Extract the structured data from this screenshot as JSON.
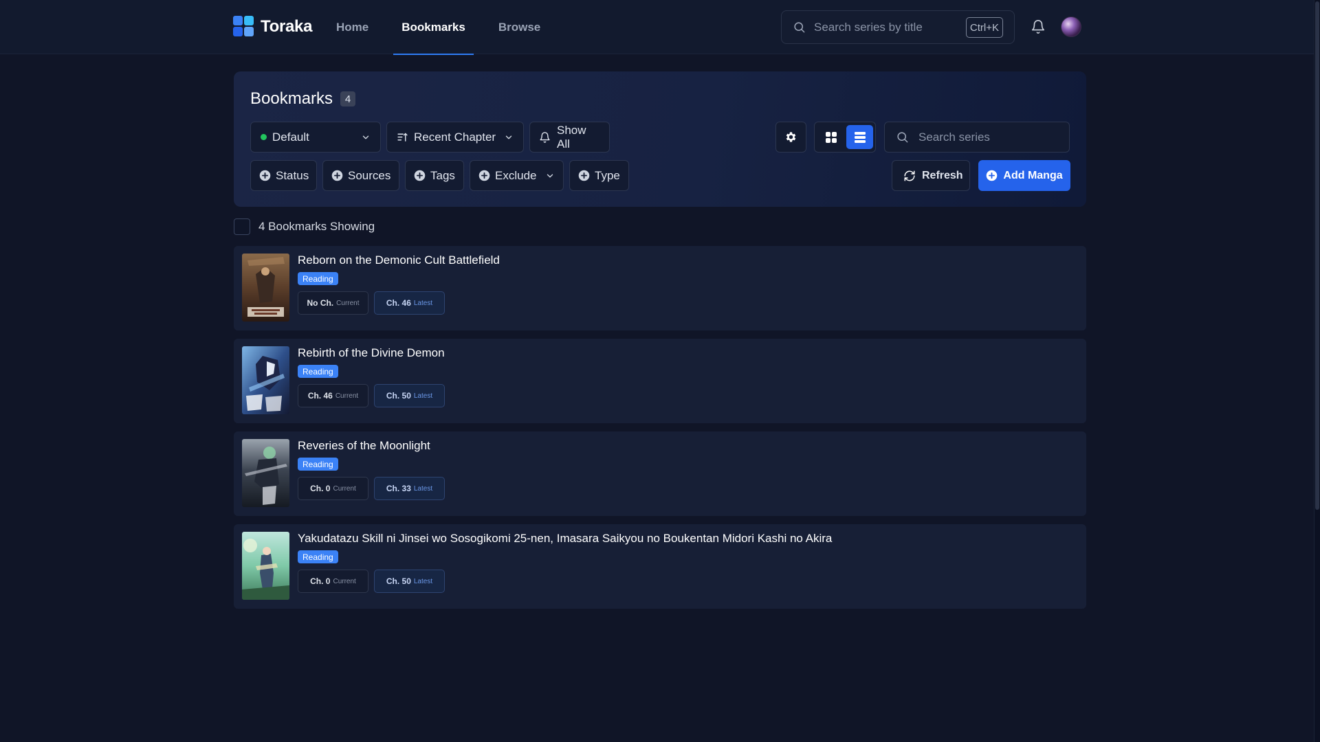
{
  "app": {
    "name": "Toraka"
  },
  "nav": {
    "items": [
      {
        "label": "Home",
        "active": false
      },
      {
        "label": "Bookmarks",
        "active": true
      },
      {
        "label": "Browse",
        "active": false
      }
    ]
  },
  "top_search": {
    "placeholder": "Search series by title",
    "shortcut": "Ctrl+K"
  },
  "icons": {
    "notifications": "bell-icon",
    "user": "avatar"
  },
  "panel": {
    "title": "Bookmarks",
    "count": "4",
    "list_filter": {
      "label": "Default",
      "status_color": "#22c55e"
    },
    "sort": {
      "label": "Recent Chapter"
    },
    "notify": {
      "label": "Show All"
    },
    "filters": {
      "status": "Status",
      "sources": "Sources",
      "tags": "Tags",
      "exclude": "Exclude",
      "type": "Type"
    },
    "view_mode": "list",
    "search_placeholder": "Search series",
    "refresh_label": "Refresh",
    "add_label": "Add Manga"
  },
  "showing": {
    "label": "4 Bookmarks Showing"
  },
  "colors": {
    "accent": "#2563eb",
    "reading_badge": "#3b82f6",
    "background": "#101527"
  },
  "bookmarks": [
    {
      "title": "Reborn on the Demonic Cult Battlefield",
      "status": "Reading",
      "current": {
        "value": "No Ch.",
        "label": "Current"
      },
      "latest": {
        "value": "Ch. 46",
        "label": "Latest"
      }
    },
    {
      "title": "Rebirth of the Divine Demon",
      "status": "Reading",
      "current": {
        "value": "Ch. 46",
        "label": "Current"
      },
      "latest": {
        "value": "Ch. 50",
        "label": "Latest"
      }
    },
    {
      "title": "Reveries of the Moonlight",
      "status": "Reading",
      "current": {
        "value": "Ch. 0",
        "label": "Current"
      },
      "latest": {
        "value": "Ch. 33",
        "label": "Latest"
      }
    },
    {
      "title": "Yakudatazu Skill ni Jinsei wo Sosogikomi 25-nen, Imasara Saikyou no Boukentan Midori Kashi no Akira",
      "status": "Reading",
      "current": {
        "value": "Ch. 0",
        "label": "Current"
      },
      "latest": {
        "value": "Ch. 50",
        "label": "Latest"
      }
    }
  ]
}
